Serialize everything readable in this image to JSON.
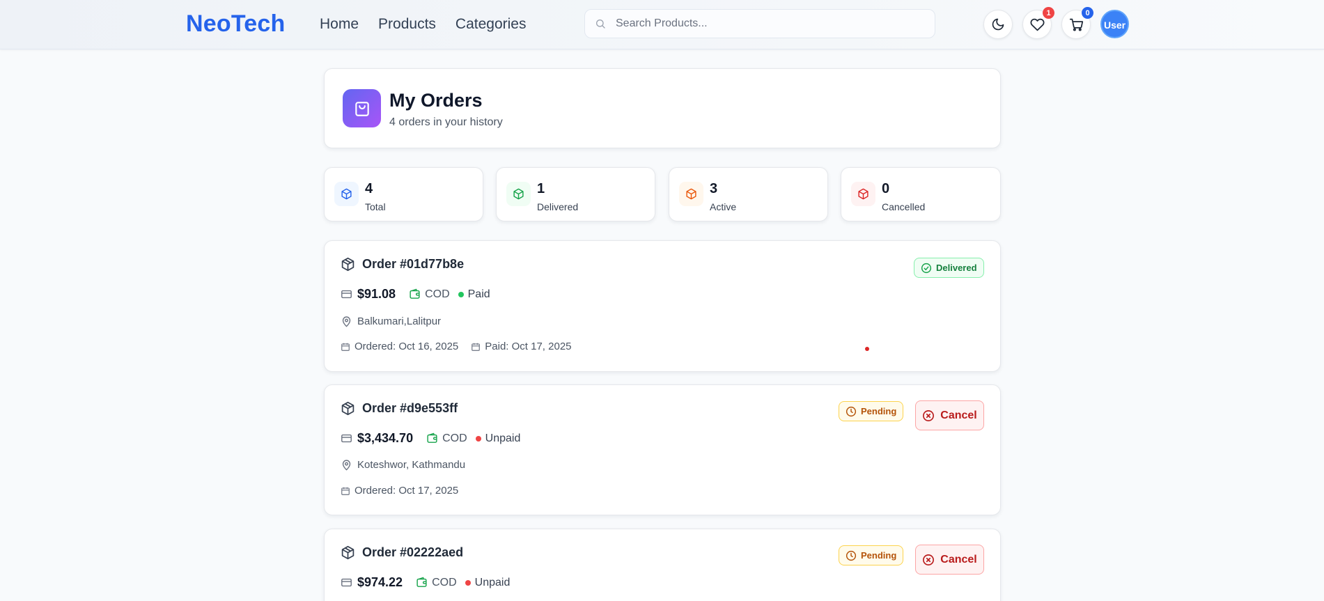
{
  "header": {
    "logo": "NeoTech",
    "nav": [
      "Home",
      "Products",
      "Categories"
    ],
    "search_placeholder": "Search Products...",
    "wishlist_count": "1",
    "cart_count": "0",
    "avatar_alt": "User"
  },
  "page": {
    "title": "My Orders",
    "subtitle": "4 orders in your history"
  },
  "stats": [
    {
      "value": "4",
      "label": "Total",
      "color": "#2563eb"
    },
    {
      "value": "1",
      "label": "Delivered",
      "color": "#16a34a"
    },
    {
      "value": "3",
      "label": "Active",
      "color": "#ea580c"
    },
    {
      "value": "0",
      "label": "Cancelled",
      "color": "#dc2626"
    }
  ],
  "orders": [
    {
      "title": "Order #01d77b8e",
      "status": "Delivered",
      "amount": "$91.08",
      "method": "COD",
      "payment": "Paid",
      "address": "Balkumari,Lalitpur",
      "ordered": "Ordered: Oct 16, 2025",
      "paid": "Paid: Oct 17, 2025"
    },
    {
      "title": "Order #d9e553ff",
      "status": "Pending",
      "amount": "$3,434.70",
      "method": "COD",
      "payment": "Unpaid",
      "address": "Koteshwor, Kathmandu",
      "ordered": "Ordered: Oct 17, 2025",
      "cancel_label": "Cancel"
    },
    {
      "title": "Order #02222aed",
      "status": "Pending",
      "amount": "$974.22",
      "method": "COD",
      "payment": "Unpaid",
      "cancel_label": "Cancel"
    }
  ],
  "colors": {
    "brand": "#2563eb",
    "paid": "#22c55e",
    "unpaid": "#ef4444",
    "wishlist_badge": "#ef4444",
    "cart_badge": "#2563eb"
  }
}
